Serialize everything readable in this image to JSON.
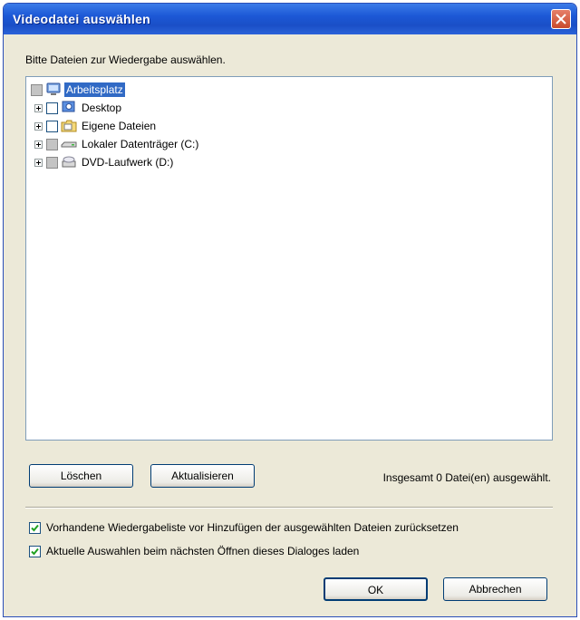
{
  "window": {
    "title": "Videodatei auswählen",
    "close_icon": "close-icon"
  },
  "instruction": "Bitte Dateien zur Wiedergabe auswählen.",
  "tree": {
    "items": [
      {
        "label": "Arbeitsplatz",
        "icon": "computer-icon",
        "selected": true,
        "checkbox": "grey"
      },
      {
        "label": "Desktop",
        "icon": "desktop-icon",
        "checkbox": "white"
      },
      {
        "label": "Eigene Dateien",
        "icon": "folder-icon",
        "checkbox": "white"
      },
      {
        "label": "Lokaler Datenträger (C:)",
        "icon": "drive-icon",
        "checkbox": "grey"
      },
      {
        "label": "DVD-Laufwerk (D:)",
        "icon": "dvd-drive-icon",
        "checkbox": "grey"
      }
    ]
  },
  "buttons": {
    "delete": "Löschen",
    "refresh": "Aktualisieren",
    "ok": "OK",
    "cancel": "Abbrechen"
  },
  "status": "Insgesamt 0 Datei(en) ausgewählt.",
  "options": [
    {
      "label": "Vorhandene Wiedergabeliste vor Hinzufügen der ausgewählten Dateien zurücksetzen",
      "checked": true
    },
    {
      "label": "Aktuelle Auswahlen beim nächsten Öffnen dieses Dialoges laden",
      "checked": true
    }
  ],
  "colors": {
    "titlebar": "#1c58d6",
    "selection": "#316ac5",
    "dialog_bg": "#ece9d8"
  }
}
